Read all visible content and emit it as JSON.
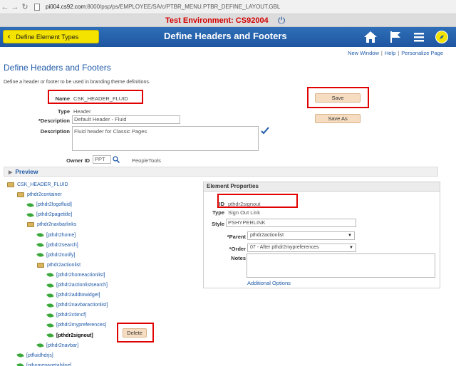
{
  "browser": {
    "url_prefix": "pi004.cs92.com",
    "url_rest": ":8000/psp/ps/EMPLOYEE/SA/c/PTBR_MENU.PTBR_DEFINE_LAYOUT.GBL"
  },
  "env": {
    "label": "Test Environment:  CS92004"
  },
  "banner": {
    "back_label": "Define Element Types",
    "title": "Define Headers and Footers"
  },
  "toplinks": {
    "new_window": "New Window",
    "help": "Help",
    "personalize": "Personalize Page"
  },
  "page": {
    "title": "Define Headers and Footers",
    "instructions": "Define a header or footer to be used in branding theme definitions."
  },
  "form": {
    "name_label": "Name",
    "name_value": "CSK_HEADER_FLUID",
    "type_label": "Type",
    "type_value": "Header",
    "desc_label": "*Description",
    "desc_value": "Default Header - Fluid",
    "longdesc_label": "Description",
    "longdesc_value": "Fluid header for Classic Pages",
    "owner_label": "Owner ID",
    "owner_value": "PPT",
    "owner_desc": "PeopleTools",
    "save_label": "Save",
    "saveas_label": "Save As"
  },
  "preview": {
    "label": "Preview"
  },
  "tree": [
    {
      "label": "CSK_HEADER_FLUID",
      "kind": "folder",
      "level": 0
    },
    {
      "label": "pthdr2container",
      "kind": "folder",
      "level": 1
    },
    {
      "label": "[pthdr2logofluid]",
      "kind": "leaf",
      "level": 2
    },
    {
      "label": "[pthdr2pagetitle]",
      "kind": "leaf",
      "level": 2
    },
    {
      "label": "pthdr2navbarlinks",
      "kind": "folder",
      "level": 2
    },
    {
      "label": "[pthdr2home]",
      "kind": "leaf",
      "level": 3
    },
    {
      "label": "[pthdr2search]",
      "kind": "leaf",
      "level": 3
    },
    {
      "label": "[pthdr2notify]",
      "kind": "leaf",
      "level": 3
    },
    {
      "label": "pthdr2actionlist",
      "kind": "folder",
      "level": 3
    },
    {
      "label": "[pthdr2homeactionlist]",
      "kind": "leaf",
      "level": 4
    },
    {
      "label": "[pthdr2actionlistsearch]",
      "kind": "leaf",
      "level": 4
    },
    {
      "label": "[pthdr2addtowidget]",
      "kind": "leaf",
      "level": 4
    },
    {
      "label": "[pthdr2navbaractionlist]",
      "kind": "leaf",
      "level": 4
    },
    {
      "label": "[pthdr2ctimcf]",
      "kind": "leaf",
      "level": 4
    },
    {
      "label": "[pthdr2mypreferences]",
      "kind": "leaf",
      "level": 4
    },
    {
      "label": "[pthdr2signout]",
      "kind": "leaf",
      "level": 4,
      "selected": true
    },
    {
      "label": "[pthdr2navbar]",
      "kind": "leaf",
      "level": 3
    },
    {
      "label": "[ptfluidhdrjs]",
      "kind": "leaf",
      "level": 1
    },
    {
      "label": "[pthomepagetabline]",
      "kind": "leaf",
      "level": 1
    }
  ],
  "tree_delete_label": "Delete",
  "element_properties": {
    "header": "Element Properties",
    "id_label": "ID",
    "id_value": "pthdr2signout",
    "type_label": "Type",
    "type_value": "Sign Out Link",
    "style_label": "Style",
    "style_value": "PSHYPERLINK",
    "parent_label": "*Parent",
    "parent_value": "pthdr2actionlist",
    "order_label": "*Order",
    "order_value": "07 - After pthdr2mypreferences",
    "notes_label": "Notes",
    "notes_value": "",
    "additional_options": "Additional Options"
  }
}
